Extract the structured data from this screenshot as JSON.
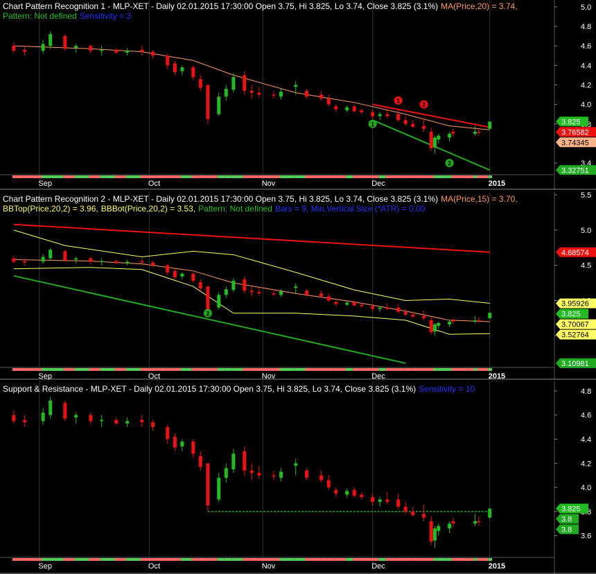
{
  "colors": {
    "background": "#000000",
    "bull": "#22bb22",
    "bear": "#ee1111",
    "grid": "#333333",
    "ma": "#ff9966",
    "bollinger": "#ffff66",
    "support": "#22aa22",
    "resistance": "#ee1111",
    "axis_text": "#ffffff"
  },
  "panels": [
    {
      "title_text": "Chart Pattern Recognition 1  - MLP-XET - Daily 02.01.2015 17:30:00 Open 3.75, Hi 3.825, Lo 3.74, Close 3.825 (3.1%)",
      "ma_label": "MA(Price,20) = 3.74,",
      "pattern_label": "Pattern: Not defined",
      "sensitivity_label": "Sensitivity = 3",
      "y_ticks": [
        "5.0",
        "4.8",
        "4.6",
        "4.4",
        "4.2",
        "4.0",
        "3.8",
        "3.4"
      ],
      "price_tags": [
        {
          "text": "3.825",
          "value": 3.825,
          "kind": "close"
        },
        {
          "text": "3.76582",
          "value": 3.76582,
          "kind": "resistance"
        },
        {
          "text": "3.74345",
          "value": 3.74345,
          "kind": "ma"
        },
        {
          "text": "3.32751",
          "value": 3.32751,
          "kind": "support"
        }
      ],
      "markers": [
        {
          "text": "1",
          "kind": "resistance",
          "date": "2014-12-08",
          "price": 4.04
        },
        {
          "text": "2",
          "kind": "resistance",
          "date": "2014-12-15",
          "price": 4.0
        },
        {
          "text": "1",
          "kind": "support",
          "date": "2014-12-01",
          "price": 3.8
        },
        {
          "text": "2",
          "kind": "support",
          "date": "2014-12-22",
          "price": 3.4
        }
      ]
    },
    {
      "title_text": "Chart Pattern Recognition 2 - MLP-XET - Daily 02.01.2015 17:30:00 Open 3.75, Hi 3.825, Lo 3.74, Close 3.825 (3.1%)",
      "ma_label": "MA(Price,15) = 3.70,",
      "bbtop_label": "BBTop(Price,20,2) = 3.96,",
      "bbbot_label": "BBBot(Price,20,2) = 3.53,",
      "pattern_label": "Pattern: Not defined",
      "bars_label": "Bars = 9, Min.Vertical Size (*ATR) = 0.00",
      "y_ticks": [
        "5.5",
        "5.0",
        "4.5",
        "4.0",
        "3.5"
      ],
      "price_tags": [
        {
          "text": "4.68574",
          "value": 4.68574,
          "kind": "resistance"
        },
        {
          "text": "3.95926",
          "value": 3.95926,
          "kind": "bollinger"
        },
        {
          "text": "3.825",
          "value": 3.825,
          "kind": "close"
        },
        {
          "text": "3.70067",
          "value": 3.70067,
          "kind": "bollinger"
        },
        {
          "text": "3.52764",
          "value": 3.52764,
          "kind": "bollinger"
        },
        {
          "text": "3.10981",
          "value": 3.10981,
          "kind": "support"
        }
      ],
      "markers": [
        {
          "text": "2",
          "kind": "support",
          "date": "2014-10-17",
          "price": 3.82
        }
      ]
    },
    {
      "title_text": "Support & Resistance - MLP-XET - Daily 02.01.2015 17:30:00 Open 3.75, Hi 3.825, Lo 3.74, Close 3.825 (3.1%)",
      "sensitivity_label": "Sensitivity = 10",
      "y_ticks": [
        "4.8",
        "4.6",
        "4.4",
        "4.2",
        "4.0",
        "3.8",
        "3.6"
      ],
      "price_tags": [
        {
          "text": "3.825",
          "value": 3.825,
          "kind": "close"
        },
        {
          "text": "3.8",
          "value": 3.8,
          "kind": "support"
        },
        {
          "text": "3.8",
          "value": 3.8,
          "kind": "support"
        }
      ],
      "markers": []
    }
  ],
  "x_labels": [
    "Sep",
    "Oct",
    "Nov",
    "Dec",
    "2015"
  ],
  "chart_data": {
    "type": "candlestick",
    "symbol": "MLP-XET",
    "interval": "Daily",
    "x_range": [
      "2014-08-25",
      "2015-01-02"
    ],
    "bars": [
      {
        "date": "2014-08-25",
        "open": 4.6,
        "high": 4.64,
        "low": 4.53,
        "close": 4.55
      },
      {
        "date": "2014-08-28",
        "open": 4.56,
        "high": 4.6,
        "low": 4.5,
        "close": 4.54
      },
      {
        "date": "2014-09-02",
        "open": 4.55,
        "high": 4.66,
        "low": 4.52,
        "close": 4.62
      },
      {
        "date": "2014-09-04",
        "open": 4.6,
        "high": 4.75,
        "low": 4.57,
        "close": 4.72
      },
      {
        "date": "2014-09-08",
        "open": 4.7,
        "high": 4.72,
        "low": 4.55,
        "close": 4.57
      },
      {
        "date": "2014-09-11",
        "open": 4.58,
        "high": 4.62,
        "low": 4.53,
        "close": 4.6
      },
      {
        "date": "2014-09-15",
        "open": 4.6,
        "high": 4.62,
        "low": 4.52,
        "close": 4.55
      },
      {
        "date": "2014-09-18",
        "open": 4.55,
        "high": 4.6,
        "low": 4.5,
        "close": 4.56
      },
      {
        "date": "2014-09-22",
        "open": 4.56,
        "high": 4.58,
        "low": 4.52,
        "close": 4.53
      },
      {
        "date": "2014-09-25",
        "open": 4.53,
        "high": 4.58,
        "low": 4.5,
        "close": 4.55
      },
      {
        "date": "2014-09-29",
        "open": 4.56,
        "high": 4.6,
        "low": 4.5,
        "close": 4.54
      },
      {
        "date": "2014-10-02",
        "open": 4.54,
        "high": 4.56,
        "low": 4.47,
        "close": 4.5
      },
      {
        "date": "2014-10-06",
        "open": 4.5,
        "high": 4.52,
        "low": 4.36,
        "close": 4.4
      },
      {
        "date": "2014-10-08",
        "open": 4.42,
        "high": 4.45,
        "low": 4.3,
        "close": 4.33
      },
      {
        "date": "2014-10-10",
        "open": 4.34,
        "high": 4.4,
        "low": 4.3,
        "close": 4.38
      },
      {
        "date": "2014-10-13",
        "open": 4.38,
        "high": 4.4,
        "low": 4.25,
        "close": 4.28
      },
      {
        "date": "2014-10-15",
        "open": 4.26,
        "high": 4.3,
        "low": 4.14,
        "close": 4.17
      },
      {
        "date": "2014-10-17",
        "open": 4.2,
        "high": 4.2,
        "low": 3.8,
        "close": 3.85
      },
      {
        "date": "2014-10-20",
        "open": 3.9,
        "high": 4.12,
        "low": 3.88,
        "close": 4.08
      },
      {
        "date": "2014-10-22",
        "open": 4.08,
        "high": 4.2,
        "low": 4.04,
        "close": 4.16
      },
      {
        "date": "2014-10-24",
        "open": 4.15,
        "high": 4.32,
        "low": 4.12,
        "close": 4.28
      },
      {
        "date": "2014-10-27",
        "open": 4.3,
        "high": 4.34,
        "low": 4.1,
        "close": 4.14
      },
      {
        "date": "2014-10-29",
        "open": 4.14,
        "high": 4.2,
        "low": 4.06,
        "close": 4.12
      },
      {
        "date": "2014-10-31",
        "open": 4.12,
        "high": 4.18,
        "low": 4.07,
        "close": 4.1
      },
      {
        "date": "2014-11-04",
        "open": 4.1,
        "high": 4.14,
        "low": 4.06,
        "close": 4.09
      },
      {
        "date": "2014-11-06",
        "open": 4.08,
        "high": 4.16,
        "low": 4.05,
        "close": 4.13
      },
      {
        "date": "2014-11-10",
        "open": 4.18,
        "high": 4.24,
        "low": 4.1,
        "close": 4.2
      },
      {
        "date": "2014-11-13",
        "open": 4.14,
        "high": 4.16,
        "low": 4.06,
        "close": 4.08
      },
      {
        "date": "2014-11-17",
        "open": 4.1,
        "high": 4.14,
        "low": 4.04,
        "close": 4.06
      },
      {
        "date": "2014-11-19",
        "open": 4.06,
        "high": 4.1,
        "low": 3.98,
        "close": 4.0
      },
      {
        "date": "2014-11-21",
        "open": 3.98,
        "high": 4.0,
        "low": 3.92,
        "close": 3.95
      },
      {
        "date": "2014-11-24",
        "open": 3.94,
        "high": 3.99,
        "low": 3.92,
        "close": 3.97
      },
      {
        "date": "2014-11-26",
        "open": 3.98,
        "high": 4.0,
        "low": 3.92,
        "close": 3.93
      },
      {
        "date": "2014-11-28",
        "open": 3.94,
        "high": 3.96,
        "low": 3.9,
        "close": 3.92
      },
      {
        "date": "2014-12-01",
        "open": 3.92,
        "high": 3.95,
        "low": 3.85,
        "close": 3.88
      },
      {
        "date": "2014-12-03",
        "open": 3.88,
        "high": 3.92,
        "low": 3.84,
        "close": 3.9
      },
      {
        "date": "2014-12-05",
        "open": 3.9,
        "high": 3.96,
        "low": 3.86,
        "close": 3.88
      },
      {
        "date": "2014-12-08",
        "open": 3.9,
        "high": 3.95,
        "low": 3.82,
        "close": 3.84
      },
      {
        "date": "2014-12-10",
        "open": 3.84,
        "high": 3.88,
        "low": 3.78,
        "close": 3.8
      },
      {
        "date": "2014-12-12",
        "open": 3.8,
        "high": 3.84,
        "low": 3.76,
        "close": 3.77
      },
      {
        "date": "2014-12-15",
        "open": 3.78,
        "high": 3.86,
        "low": 3.72,
        "close": 3.75
      },
      {
        "date": "2014-12-17",
        "open": 3.72,
        "high": 3.76,
        "low": 3.52,
        "close": 3.55
      },
      {
        "date": "2014-12-18",
        "open": 3.56,
        "high": 3.68,
        "low": 3.5,
        "close": 3.66
      },
      {
        "date": "2014-12-19",
        "open": 3.64,
        "high": 3.7,
        "low": 3.6,
        "close": 3.68
      },
      {
        "date": "2014-12-22",
        "open": 3.66,
        "high": 3.72,
        "low": 3.62,
        "close": 3.7
      },
      {
        "date": "2014-12-23",
        "open": 3.72,
        "high": 3.75,
        "low": 3.67,
        "close": 3.7
      },
      {
        "date": "2014-12-29",
        "open": 3.7,
        "high": 3.78,
        "low": 3.68,
        "close": 3.72
      },
      {
        "date": "2014-12-30",
        "open": 3.72,
        "high": 3.76,
        "low": 3.68,
        "close": 3.71
      },
      {
        "date": "2015-01-02",
        "open": 3.75,
        "high": 3.825,
        "low": 3.74,
        "close": 3.825
      }
    ],
    "ma20": [
      {
        "date": "2014-08-25",
        "value": 4.6
      },
      {
        "date": "2014-09-15",
        "value": 4.57
      },
      {
        "date": "2014-09-29",
        "value": 4.54
      },
      {
        "date": "2014-10-13",
        "value": 4.45
      },
      {
        "date": "2014-10-24",
        "value": 4.3
      },
      {
        "date": "2014-11-10",
        "value": 4.12
      },
      {
        "date": "2014-11-26",
        "value": 4.02
      },
      {
        "date": "2014-12-10",
        "value": 3.9
      },
      {
        "date": "2014-12-22",
        "value": 3.78
      },
      {
        "date": "2015-01-02",
        "value": 3.74
      }
    ],
    "ma15": [
      {
        "date": "2014-08-25",
        "value": 4.58
      },
      {
        "date": "2014-09-15",
        "value": 4.56
      },
      {
        "date": "2014-09-29",
        "value": 4.52
      },
      {
        "date": "2014-10-13",
        "value": 4.42
      },
      {
        "date": "2014-10-24",
        "value": 4.25
      },
      {
        "date": "2014-11-10",
        "value": 4.1
      },
      {
        "date": "2014-11-26",
        "value": 3.98
      },
      {
        "date": "2014-12-10",
        "value": 3.85
      },
      {
        "date": "2014-12-22",
        "value": 3.72
      },
      {
        "date": "2015-01-02",
        "value": 3.7
      }
    ],
    "bb_top": [
      {
        "date": "2014-08-25",
        "value": 5.0
      },
      {
        "date": "2014-09-08",
        "value": 4.78
      },
      {
        "date": "2014-09-29",
        "value": 4.62
      },
      {
        "date": "2014-10-13",
        "value": 4.7
      },
      {
        "date": "2014-10-24",
        "value": 4.65
      },
      {
        "date": "2014-11-10",
        "value": 4.4
      },
      {
        "date": "2014-11-26",
        "value": 4.15
      },
      {
        "date": "2014-12-10",
        "value": 4.0
      },
      {
        "date": "2014-12-22",
        "value": 4.02
      },
      {
        "date": "2015-01-02",
        "value": 3.96
      }
    ],
    "bb_bot": [
      {
        "date": "2014-08-25",
        "value": 4.45
      },
      {
        "date": "2014-09-15",
        "value": 4.47
      },
      {
        "date": "2014-09-29",
        "value": 4.44
      },
      {
        "date": "2014-10-13",
        "value": 4.2
      },
      {
        "date": "2014-10-24",
        "value": 3.82
      },
      {
        "date": "2014-11-10",
        "value": 3.82
      },
      {
        "date": "2014-11-26",
        "value": 3.78
      },
      {
        "date": "2014-12-10",
        "value": 3.72
      },
      {
        "date": "2014-12-22",
        "value": 3.52
      },
      {
        "date": "2015-01-02",
        "value": 3.53
      }
    ],
    "trendlines": [
      {
        "panel": 0,
        "kind": "resistance",
        "from": {
          "date": "2014-12-01",
          "value": 4.0
        },
        "to": {
          "date": "2015-01-02",
          "value": 3.76582
        }
      },
      {
        "panel": 0,
        "kind": "support",
        "from": {
          "date": "2014-12-01",
          "value": 3.84
        },
        "to": {
          "date": "2015-01-02",
          "value": 3.32751
        }
      },
      {
        "panel": 1,
        "kind": "resistance",
        "from": {
          "date": "2014-08-25",
          "value": 5.08
        },
        "to": {
          "date": "2015-01-02",
          "value": 4.68574
        }
      },
      {
        "panel": 1,
        "kind": "support",
        "from": {
          "date": "2014-08-25",
          "value": 4.35
        },
        "to": {
          "date": "2014-12-10",
          "value": 3.10981
        }
      },
      {
        "panel": 2,
        "kind": "support",
        "from": {
          "date": "2014-10-17",
          "value": 3.8
        },
        "to": {
          "date": "2015-01-02",
          "value": 3.8
        }
      }
    ]
  }
}
